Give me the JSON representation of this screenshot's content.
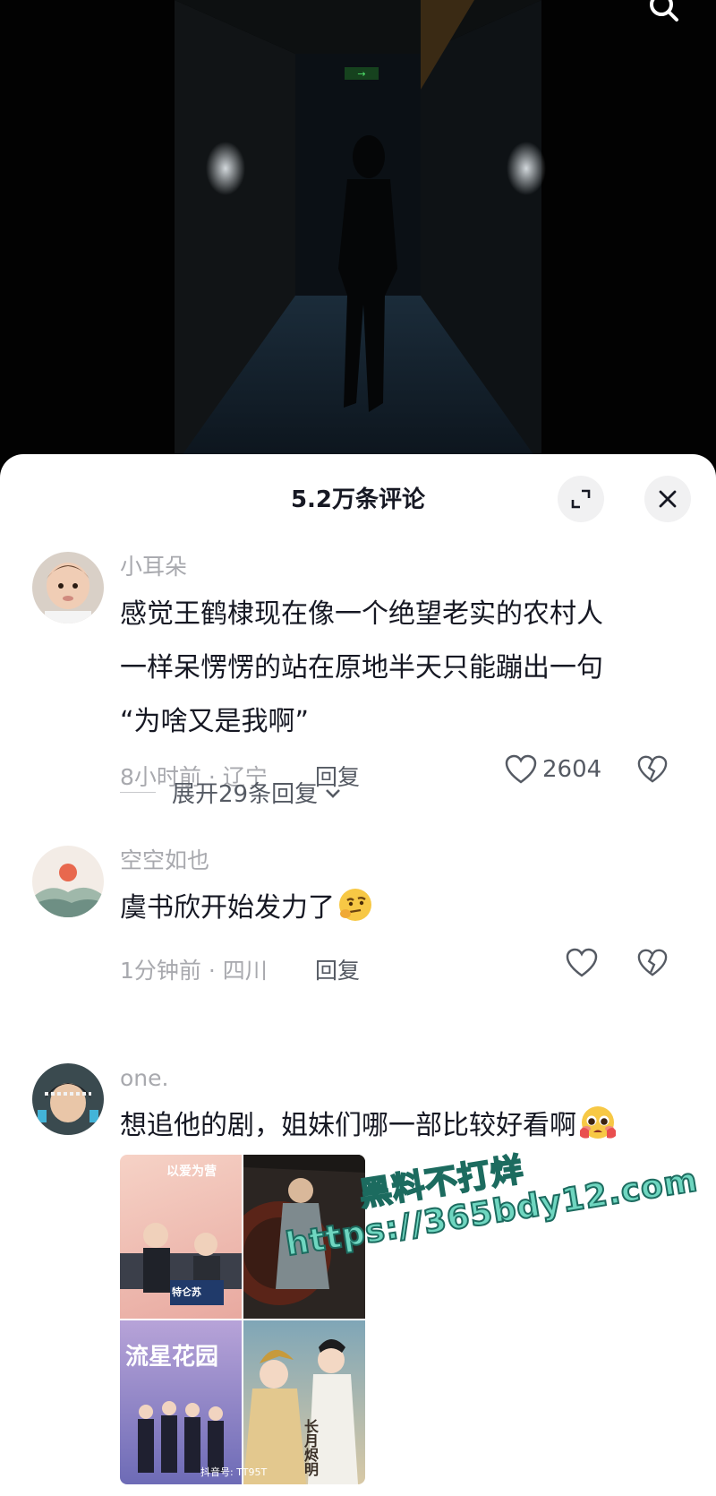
{
  "sheet": {
    "title": "5.2万条评论"
  },
  "exit_sign": "→",
  "comments": [
    {
      "username": "小耳朵",
      "text_lines": [
        "感觉王鹤棣现在像一个绝望老实的农村人",
        "一样呆愣愣的站在原地半天只能蹦出一句",
        "“为啥又是我啊”"
      ],
      "time_location": "8小时前 · 辽宁",
      "reply_label": "回复",
      "likes": "2604",
      "expand_replies": "展开29条回复"
    },
    {
      "username": "空空如也",
      "text": "虞书欣开始发力了",
      "emoji": "thinking-face-emoji",
      "time_location": "1分钟前 · 四川",
      "reply_label": "回复"
    },
    {
      "username": "one.",
      "text": "想追他的剧，姐妹们哪一部比较好看啊",
      "emoji": "pleading-face-emoji",
      "media": {
        "posters": [
          {
            "label": "以爱为营"
          },
          {
            "label": "特仑苏"
          },
          {
            "label": "流星花园"
          },
          {
            "label": "长月烬明"
          }
        ],
        "footer": "抖音号: TT95T"
      }
    }
  ],
  "watermark": {
    "line1": "黑料不打烊",
    "line2": "https://365bdy12.com"
  },
  "colors": {
    "sheet_bg": "#ffffff",
    "text_primary": "#161823",
    "text_secondary": "#a8a9ae",
    "action_text": "#555a63",
    "watermark": "#6fd6c0"
  }
}
